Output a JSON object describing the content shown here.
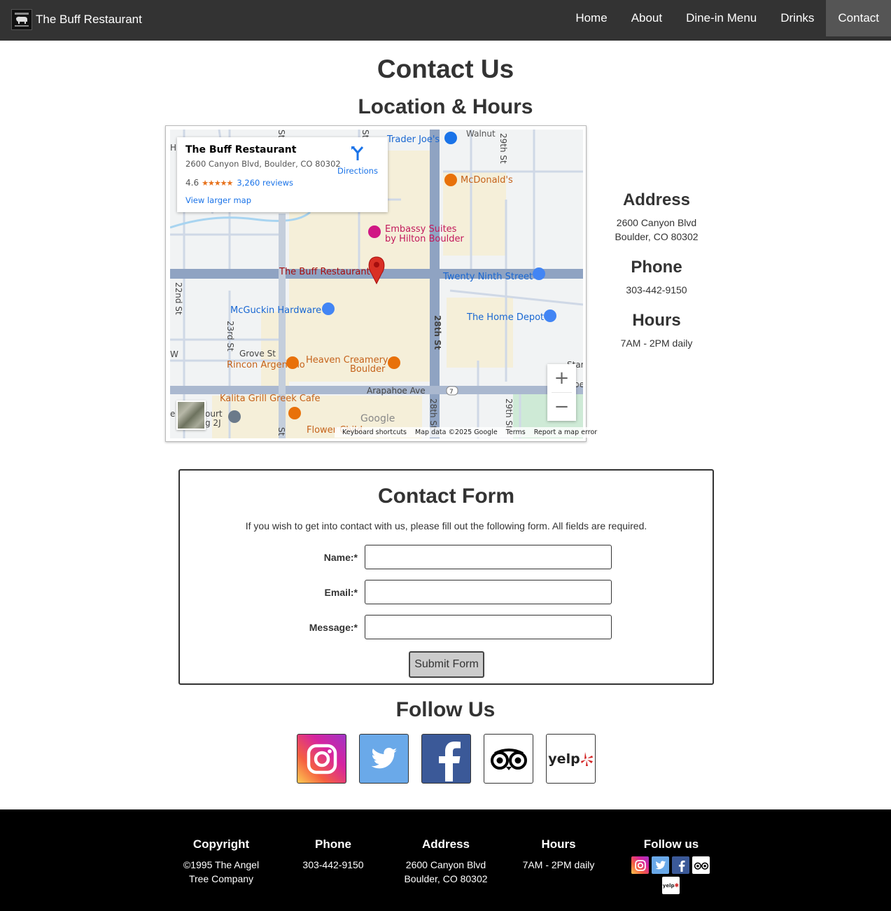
{
  "navbar": {
    "brand": "The Buff Restaurant",
    "links": [
      "Home",
      "About",
      "Dine-in Menu",
      "Drinks",
      "Contact"
    ]
  },
  "page": {
    "title": "Contact Us",
    "location_heading": "Location & Hours"
  },
  "map": {
    "card": {
      "name": "The Buff Restaurant",
      "address": "2600 Canyon Blvd, Boulder, CO 80302",
      "rating": "4.6",
      "stars": "★★★★★",
      "reviews": "3,260 reviews",
      "larger_map": "View larger map",
      "directions": "Directions"
    },
    "labels": {
      "trader_joes": "Trader Joe's",
      "walnut": "Walnut",
      "mcdonalds": "McDonald's",
      "embassy1": "Embassy Suites",
      "embassy2": "by Hilton Boulder",
      "buff": "The Buff Restaurant",
      "twenty_ninth": "Twenty Ninth Street",
      "mcguckin": "McGuckin Hardware",
      "home_depot": "The Home Depot",
      "st22": "22nd St",
      "st23": "23rd St",
      "st28": "28th St",
      "st29a": "29th St",
      "st29b": "29th St",
      "grove": "Grove St",
      "rincon": "Rincon Argentino",
      "heaven1": "Heaven Creamery",
      "heaven2": "Boulder",
      "arapahoe": "Arapahoe Ave",
      "route7": "7",
      "kalita": "Kalita Grill Greek Cafe",
      "flower": "Flower Child",
      "court": "ourt",
      "court2": "g 2J",
      "star": "Star",
      "be": "be",
      "h_edge": "H",
      "w_edge": "W",
      "e_edge": "e",
      "st_a": "St",
      "st_b": "St",
      "st_c": "St"
    },
    "zoom_in": "+",
    "zoom_out": "−",
    "google": "Google",
    "footer": [
      "Keyboard shortcuts",
      "Map data ©2025 Google",
      "Terms",
      "Report a map error"
    ]
  },
  "info": {
    "address_heading": "Address",
    "address_line1": "2600 Canyon Blvd",
    "address_line2": "Boulder, CO 80302",
    "phone_heading": "Phone",
    "phone": "303-442-9150",
    "hours_heading": "Hours",
    "hours": "7AM - 2PM daily"
  },
  "form": {
    "title": "Contact Form",
    "description": "If you wish to get into contact with us, please fill out the following form. All fields are required.",
    "name_label": "Name:*",
    "email_label": "Email:*",
    "message_label": "Message:*",
    "name_value": "",
    "email_value": "",
    "message_value": "",
    "submit": "Submit Form"
  },
  "follow": {
    "title": "Follow Us",
    "icons": [
      "instagram-icon",
      "twitter-icon",
      "facebook-icon",
      "tripadvisor-icon",
      "yelp-icon"
    ],
    "yelp_text": "yelp"
  },
  "footer": {
    "copyright_heading": "Copyright",
    "copyright_line1": "©1995 The Angel",
    "copyright_line2": "Tree Company",
    "phone_heading": "Phone",
    "phone": "303-442-9150",
    "address_heading": "Address",
    "address_line1": "2600 Canyon Blvd",
    "address_line2": "Boulder, CO 80302",
    "hours_heading": "Hours",
    "hours": "7AM - 2PM daily",
    "follow_heading": "Follow us"
  },
  "colors": {
    "navbar": "#333333",
    "nav_active": "#555555",
    "footer": "#000000",
    "instagram": "#d6249f",
    "twitter": "#6aa9e9",
    "facebook": "#3b5998",
    "map_road": "#8fa3c2",
    "map_bg": "#f1f3f4",
    "map_commercial": "#f5efd9",
    "map_blue_label": "#1a73e8",
    "map_pin": "#d93025"
  }
}
